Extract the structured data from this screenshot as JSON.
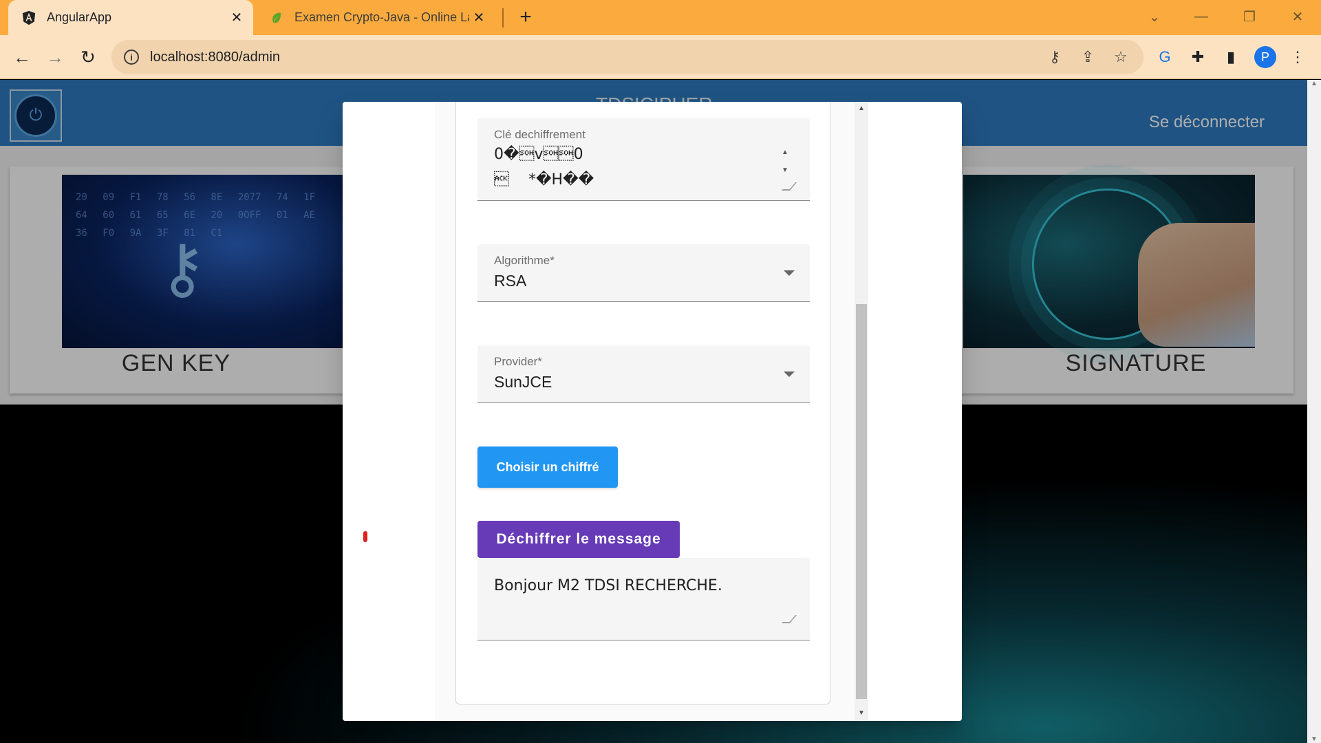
{
  "browser": {
    "tabs": [
      {
        "title": "AngularApp",
        "active": true
      },
      {
        "title": "Examen Crypto-Java - Online La",
        "active": false
      }
    ],
    "url": "localhost:8080/admin"
  },
  "app": {
    "title": "TDSICIPHER",
    "logout_label": "Se déconnecter",
    "cards": [
      {
        "caption": "GEN KEY"
      },
      {
        "caption": "SIGNATURE"
      }
    ],
    "key_image_digits": "20 09 F1 78 56 8E 2077 74 1F 64 60 61 65 6E 20 0OFF 01 AE 36 F0 9A 3F 81 C1"
  },
  "dialog": {
    "cle_field": {
      "label": "Clé dechiffrement",
      "value": "0�\u0001\"0\u0006\t*�H��\u0001\u0001\u0001\u0005\u0000\u0003�\u0001\u000f\u00000�\u0001\n\u0002�\u0001\u0001",
      "display_lines": [
        "0�\u0001v\u0001\u00010",
        "\u0006    *�H��"
      ]
    },
    "algorithm_field": {
      "label": "Algorithme*",
      "value": "RSA"
    },
    "provider_field": {
      "label": "Provider*",
      "value": "SunJCE"
    },
    "choose_button": "Choisir un chiffré",
    "decrypt_button": "Déchiffrer le message",
    "result": "Bonjour M2 TDSI RECHERCHE."
  },
  "colors": {
    "tabstrip": "#fbab3d",
    "appbar": "#2f7bc1",
    "choose_button": "#2196f3",
    "decrypt_button": "#673ab7"
  }
}
